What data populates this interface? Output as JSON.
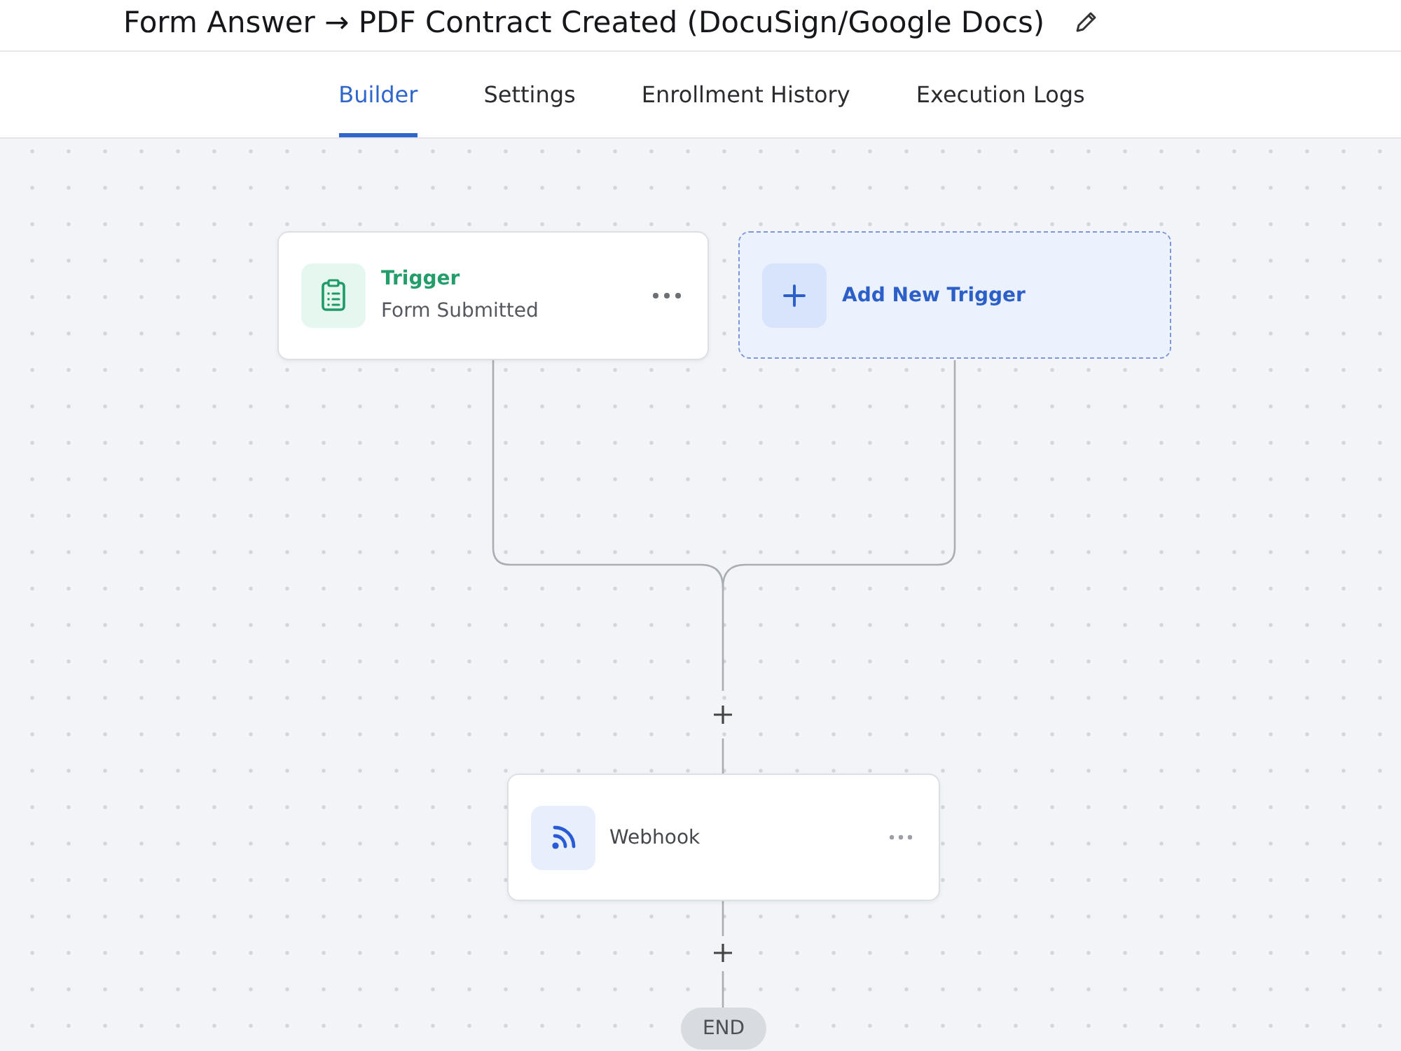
{
  "header": {
    "title": "Form Answer → PDF Contract Created (DocuSign/Google Docs)"
  },
  "tabs": [
    {
      "label": "Builder",
      "selected": true
    },
    {
      "label": "Settings",
      "selected": false
    },
    {
      "label": "Enrollment History",
      "selected": false
    },
    {
      "label": "Execution Logs",
      "selected": false
    }
  ],
  "canvas": {
    "triggers": [
      {
        "kind": "trigger",
        "title": "Trigger",
        "subtitle": "Form Submitted"
      },
      {
        "kind": "add",
        "label": "Add New Trigger"
      }
    ],
    "steps": [
      {
        "label": "Webhook"
      }
    ],
    "end_label": "END"
  }
}
